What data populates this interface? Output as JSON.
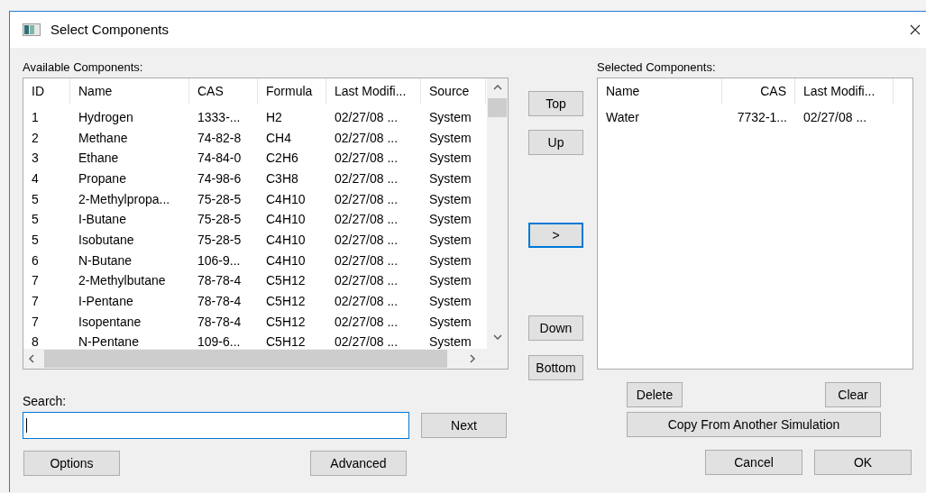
{
  "window": {
    "title": "Select Components"
  },
  "available": {
    "label": "Available Components:",
    "columns": [
      "ID",
      "Name",
      "CAS",
      "Formula",
      "Last Modifi...",
      "Source"
    ],
    "rows": [
      [
        "1",
        "Hydrogen",
        "1333-...",
        "H2",
        "02/27/08 ...",
        "System"
      ],
      [
        "2",
        "Methane",
        "74-82-8",
        "CH4",
        "02/27/08 ...",
        "System"
      ],
      [
        "3",
        "Ethane",
        "74-84-0",
        "C2H6",
        "02/27/08 ...",
        "System"
      ],
      [
        "4",
        "Propane",
        "74-98-6",
        "C3H8",
        "02/27/08 ...",
        "System"
      ],
      [
        "5",
        "2-Methylpropa...",
        "75-28-5",
        "C4H10",
        "02/27/08 ...",
        "System"
      ],
      [
        "5",
        "I-Butane",
        "75-28-5",
        "C4H10",
        "02/27/08 ...",
        "System"
      ],
      [
        "5",
        "Isobutane",
        "75-28-5",
        "C4H10",
        "02/27/08 ...",
        "System"
      ],
      [
        "6",
        "N-Butane",
        "106-9...",
        "C4H10",
        "02/27/08 ...",
        "System"
      ],
      [
        "7",
        "2-Methylbutane",
        "78-78-4",
        "C5H12",
        "02/27/08 ...",
        "System"
      ],
      [
        "7",
        "I-Pentane",
        "78-78-4",
        "C5H12",
        "02/27/08 ...",
        "System"
      ],
      [
        "7",
        "Isopentane",
        "78-78-4",
        "C5H12",
        "02/27/08 ...",
        "System"
      ],
      [
        "8",
        "N-Pentane",
        "109-6...",
        "C5H12",
        "02/27/08 ...",
        "System"
      ]
    ]
  },
  "move_buttons": [
    {
      "label": "Top",
      "focused": false
    },
    {
      "label": "Up",
      "focused": false
    },
    {
      "label": ">",
      "focused": true
    },
    {
      "label": "Down",
      "focused": false
    },
    {
      "label": "Bottom",
      "focused": false
    }
  ],
  "selected": {
    "label": "Selected Components:",
    "columns": [
      "Name",
      "CAS",
      "Last Modifi..."
    ],
    "rows": [
      [
        "Water",
        "7732-1...",
        "02/27/08 ..."
      ]
    ]
  },
  "search": {
    "label": "Search:",
    "next": "Next"
  },
  "left_buttons": [
    "Options",
    "Advanced"
  ],
  "list_buttons": [
    "Delete",
    "Clear",
    "Copy From Another Simulation"
  ],
  "dialog_buttons": [
    "Cancel",
    "OK"
  ]
}
